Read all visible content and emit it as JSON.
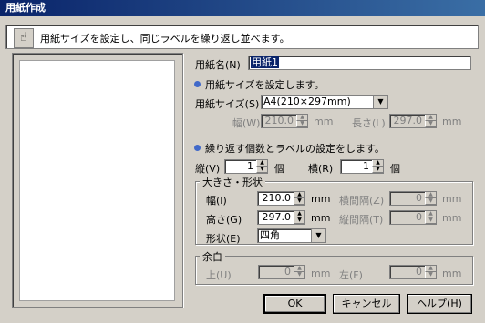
{
  "window": {
    "title": "用紙作成"
  },
  "instruction": "用紙サイズを設定し、同じラベルを繰り返し並べます。",
  "paper_name": {
    "label": "用紙名(N)",
    "value": "用紙1"
  },
  "size_section": {
    "heading": "用紙サイズを設定します。",
    "size_label": "用紙サイズ(S)",
    "size_value": "A4(210×297mm)",
    "width_label": "幅(W)",
    "width_value": "210.0",
    "width_unit": "mm",
    "length_label": "長さ(L)",
    "length_value": "297.0",
    "length_unit": "mm"
  },
  "repeat_section": {
    "heading": "繰り返す個数とラベルの設定をします。",
    "rows_label": "縦(V)",
    "rows_value": "1",
    "rows_unit": "個",
    "cols_label": "横(R)",
    "cols_value": "1",
    "cols_unit": "個"
  },
  "shape_group": {
    "title": "大きさ・形状",
    "width_label": "幅(I)",
    "width_value": "210.0",
    "width_unit": "mm",
    "height_label": "高さ(G)",
    "height_value": "297.0",
    "height_unit": "mm",
    "hgap_label": "横間隔(Z)",
    "hgap_value": "0",
    "hgap_unit": "mm",
    "vgap_label": "縦間隔(T)",
    "vgap_value": "0",
    "vgap_unit": "mm",
    "shape_label": "形状(E)",
    "shape_value": "四角"
  },
  "margin_group": {
    "title": "余白",
    "top_label": "上(U)",
    "top_value": "0",
    "top_unit": "mm",
    "left_label": "左(F)",
    "left_value": "0",
    "left_unit": "mm"
  },
  "buttons": {
    "ok": "OK",
    "cancel": "キャンセル",
    "help": "ヘルプ(H)"
  },
  "colors": {
    "titlebar": "#0a246a",
    "bullet": "#4169c9",
    "selection": "#0a246a"
  },
  "icons": {
    "instruction": "hand-icon"
  }
}
